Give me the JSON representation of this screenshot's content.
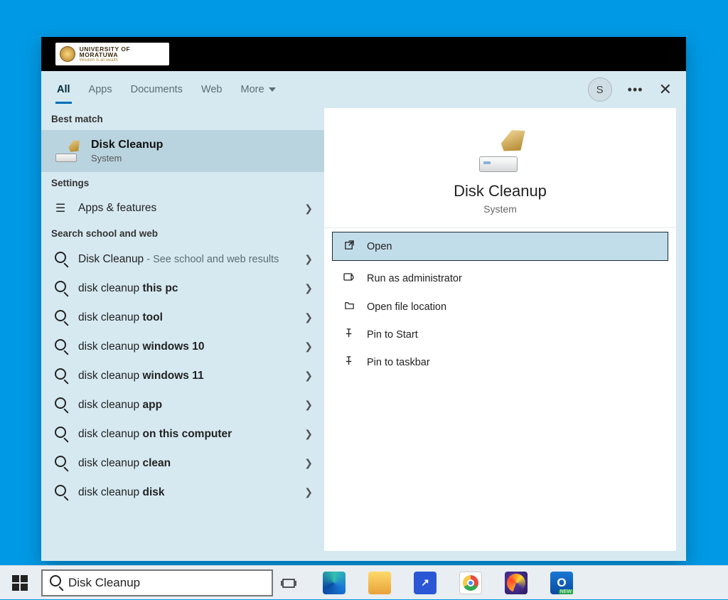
{
  "logo": {
    "line1": "UNIVERSITY OF MORATUWA",
    "line2": "Wisdom is all wealth"
  },
  "tabs": {
    "all": "All",
    "apps": "Apps",
    "documents": "Documents",
    "web": "Web",
    "more": "More"
  },
  "avatar_initial": "S",
  "left": {
    "best_match_header": "Best match",
    "best_match": {
      "title": "Disk Cleanup",
      "subtitle": "System"
    },
    "settings_header": "Settings",
    "apps_features": "Apps & features",
    "web_header": "Search school and web",
    "web0_title": "Disk Cleanup",
    "web0_hint": " - See school and web results",
    "s1a": "disk cleanup ",
    "s1b": "this pc",
    "s2a": "disk cleanup ",
    "s2b": "tool",
    "s3a": "disk cleanup ",
    "s3b": "windows 10",
    "s4a": "disk cleanup ",
    "s4b": "windows 11",
    "s5a": "disk cleanup ",
    "s5b": "app",
    "s6a": "disk cleanup ",
    "s6b": "on this computer",
    "s7a": "disk cleanup ",
    "s7b": "clean",
    "s8a": "disk cleanup ",
    "s8b": "disk"
  },
  "right": {
    "title": "Disk Cleanup",
    "subtitle": "System",
    "open": "Open",
    "run_admin": "Run as administrator",
    "open_loc": "Open file location",
    "pin_start": "Pin to Start",
    "pin_taskbar": "Pin to taskbar"
  },
  "taskbar": {
    "search_value": "Disk Cleanup"
  }
}
